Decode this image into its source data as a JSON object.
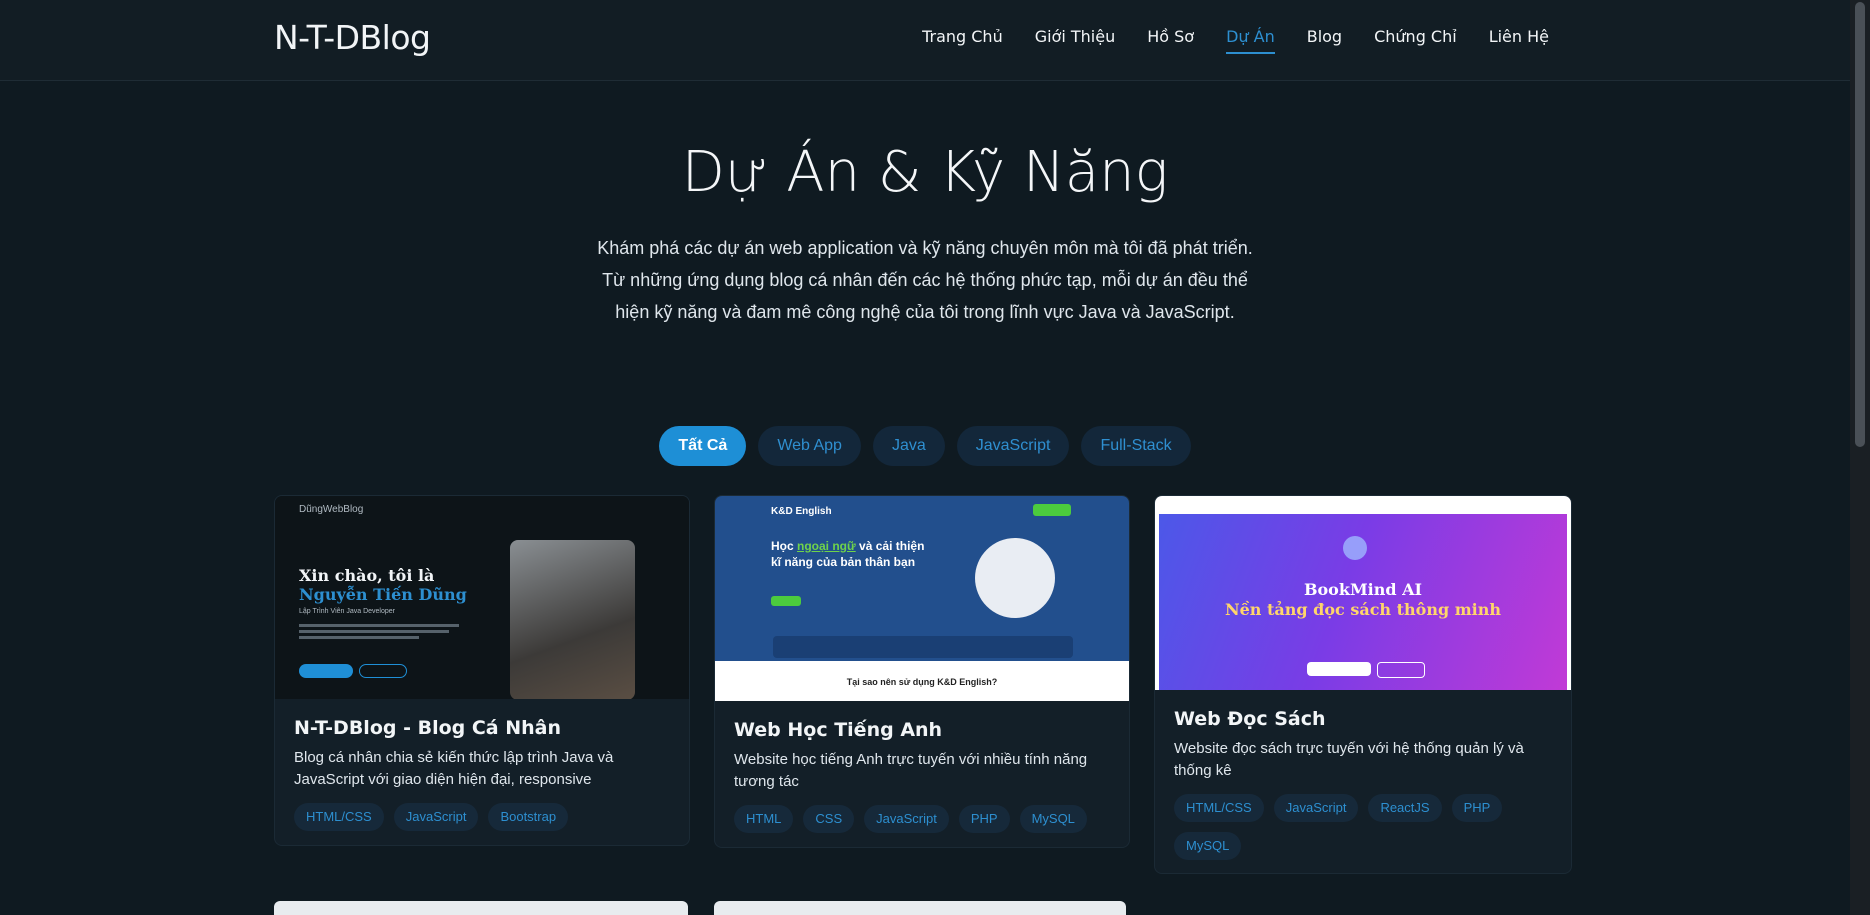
{
  "header": {
    "logo": "N-T-DBlog",
    "nav": [
      "Trang Chủ",
      "Giới Thiệu",
      "Hồ Sơ",
      "Dự Án",
      "Blog",
      "Chứng Chỉ",
      "Liên Hệ"
    ],
    "active_nav": "Dự Án"
  },
  "hero": {
    "title": "Dự Án & Kỹ Năng",
    "description_lines": [
      "Khám phá các dự án web application và kỹ năng chuyên môn mà tôi đã phát triển.",
      "Từ những ứng dụng blog cá nhân đến các hệ thống phức tạp, mỗi dự án đều thể",
      "hiện kỹ năng và đam mê công nghệ của tôi trong lĩnh vực Java và JavaScript."
    ]
  },
  "filters": [
    "Tất Cả",
    "Web App",
    "Java",
    "JavaScript",
    "Full-Stack"
  ],
  "active_filter": "Tất Cả",
  "projects": [
    {
      "title": "N-T-DBlog - Blog Cá Nhân",
      "description": "Blog cá nhân chia sẻ kiến thức lập trình Java và JavaScript với giao diện hiện đại, responsive",
      "tags": [
        "HTML/CSS",
        "JavaScript",
        "Bootstrap"
      ],
      "preview": {
        "brand": "DũngWebBlog",
        "heading_prefix": "Xin chào, tôi là",
        "heading_name": "Nguyễn Tiến Dũng",
        "subtitle": "Lập Trình Viên Java Developer"
      }
    },
    {
      "title": "Web Học Tiếng Anh",
      "description": "Website học tiếng Anh trực tuyến với nhiều tính năng tương tác",
      "tags": [
        "HTML",
        "CSS",
        "JavaScript",
        "PHP",
        "MySQL"
      ],
      "preview": {
        "brand": "K&D English",
        "heading_prefix": "Học",
        "heading_highlight": "ngoại ngữ",
        "heading_suffix": "và cải thiện kĩ năng của bản thân bạn",
        "bottom_text": "Tại sao nên sử dụng K&D English?"
      }
    },
    {
      "title": "Web Đọc Sách",
      "description": "Website đọc sách trực tuyến với hệ thống quản lý và thống kê",
      "tags": [
        "HTML/CSS",
        "JavaScript",
        "ReactJS",
        "PHP",
        "MySQL"
      ],
      "preview": {
        "line1": "BookMind AI",
        "line2": "Nền tảng đọc sách thông minh"
      }
    }
  ],
  "colors": {
    "background": "#0f1a21",
    "accent": "#1e8fd6",
    "card": "#131f28"
  }
}
